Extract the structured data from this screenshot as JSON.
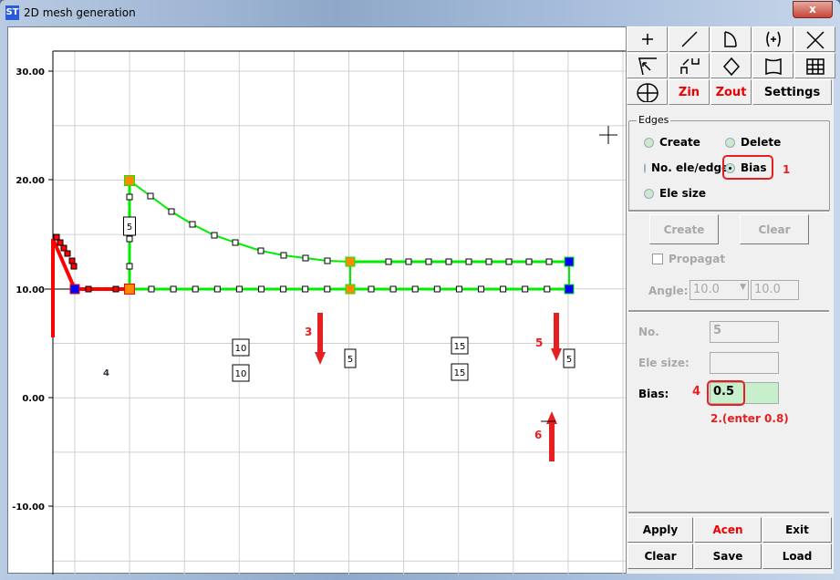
{
  "window": {
    "title": "2D mesh generation",
    "logo": "ST",
    "close": "x"
  },
  "plot": {
    "y_ticks": [
      "30.00",
      "20.00",
      "10.00",
      "0.00",
      "-10.00"
    ],
    "edge_labels": [
      "5",
      "10",
      "10",
      "5",
      "15",
      "15",
      "5",
      "4"
    ],
    "annotations": {
      "a3": "3",
      "a5": "5",
      "a6": "6"
    }
  },
  "toolbar": {
    "icons": [
      "add-point-icon",
      "line-icon",
      "arc-icon",
      "circle-center-icon",
      "intersect-icon",
      "fillet-icon",
      "move-copy-icon",
      "rotate-icon",
      "surface-icon",
      "mesh-icon",
      "globe-icon"
    ],
    "zin": "Zin",
    "zout": "Zout",
    "settings": "Settings"
  },
  "edges": {
    "legend": "Edges",
    "create": "Create",
    "delete": "Delete",
    "no_ele": "No. ele/edge",
    "bias": "Bias",
    "ele_size": "Ele size",
    "selected": "bias",
    "annotation": "1"
  },
  "actions": {
    "create": "Create",
    "clear": "Clear",
    "propagate": "Propagat",
    "angle_label": "Angle:",
    "angle_select": "10.0",
    "angle_value": "10.0"
  },
  "props": {
    "no_label": "No.",
    "no_value": "5",
    "ele_size_label": "Ele size:",
    "ele_size_value": "",
    "bias_label": "Bias:",
    "bias_value": "0.5",
    "anno4": "4",
    "anno2": "2.(enter 0.8)"
  },
  "bottom": {
    "apply": "Apply",
    "acen": "Acen",
    "exit": "Exit",
    "clear": "Clear",
    "save": "Save",
    "load": "Load"
  },
  "colors": {
    "edge": "#00ee00",
    "selected": "#ff0000",
    "annotation": "#e62020"
  }
}
